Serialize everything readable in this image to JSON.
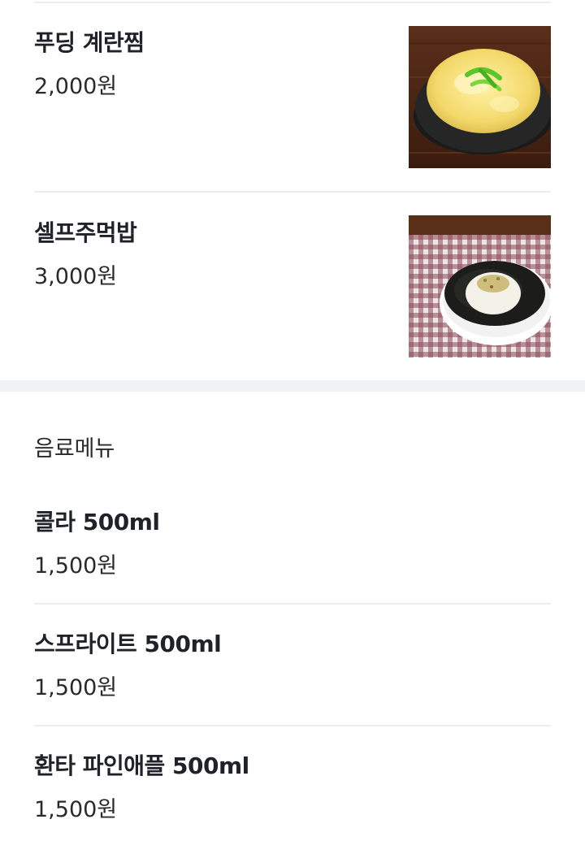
{
  "food_items": [
    {
      "name": "푸딩 계란찜",
      "price": "2,000원",
      "image": "steamed-egg-photo"
    },
    {
      "name": "셀프주먹밥",
      "price": "3,000원",
      "image": "rice-ball-photo"
    }
  ],
  "drink_section": {
    "title": "음료메뉴",
    "items": [
      {
        "name": "콜라 500ml",
        "price": "1,500원"
      },
      {
        "name": "스프라이트 500ml",
        "price": "1,500원"
      },
      {
        "name": "환타 파인애플 500ml",
        "price": "1,500원"
      }
    ]
  }
}
